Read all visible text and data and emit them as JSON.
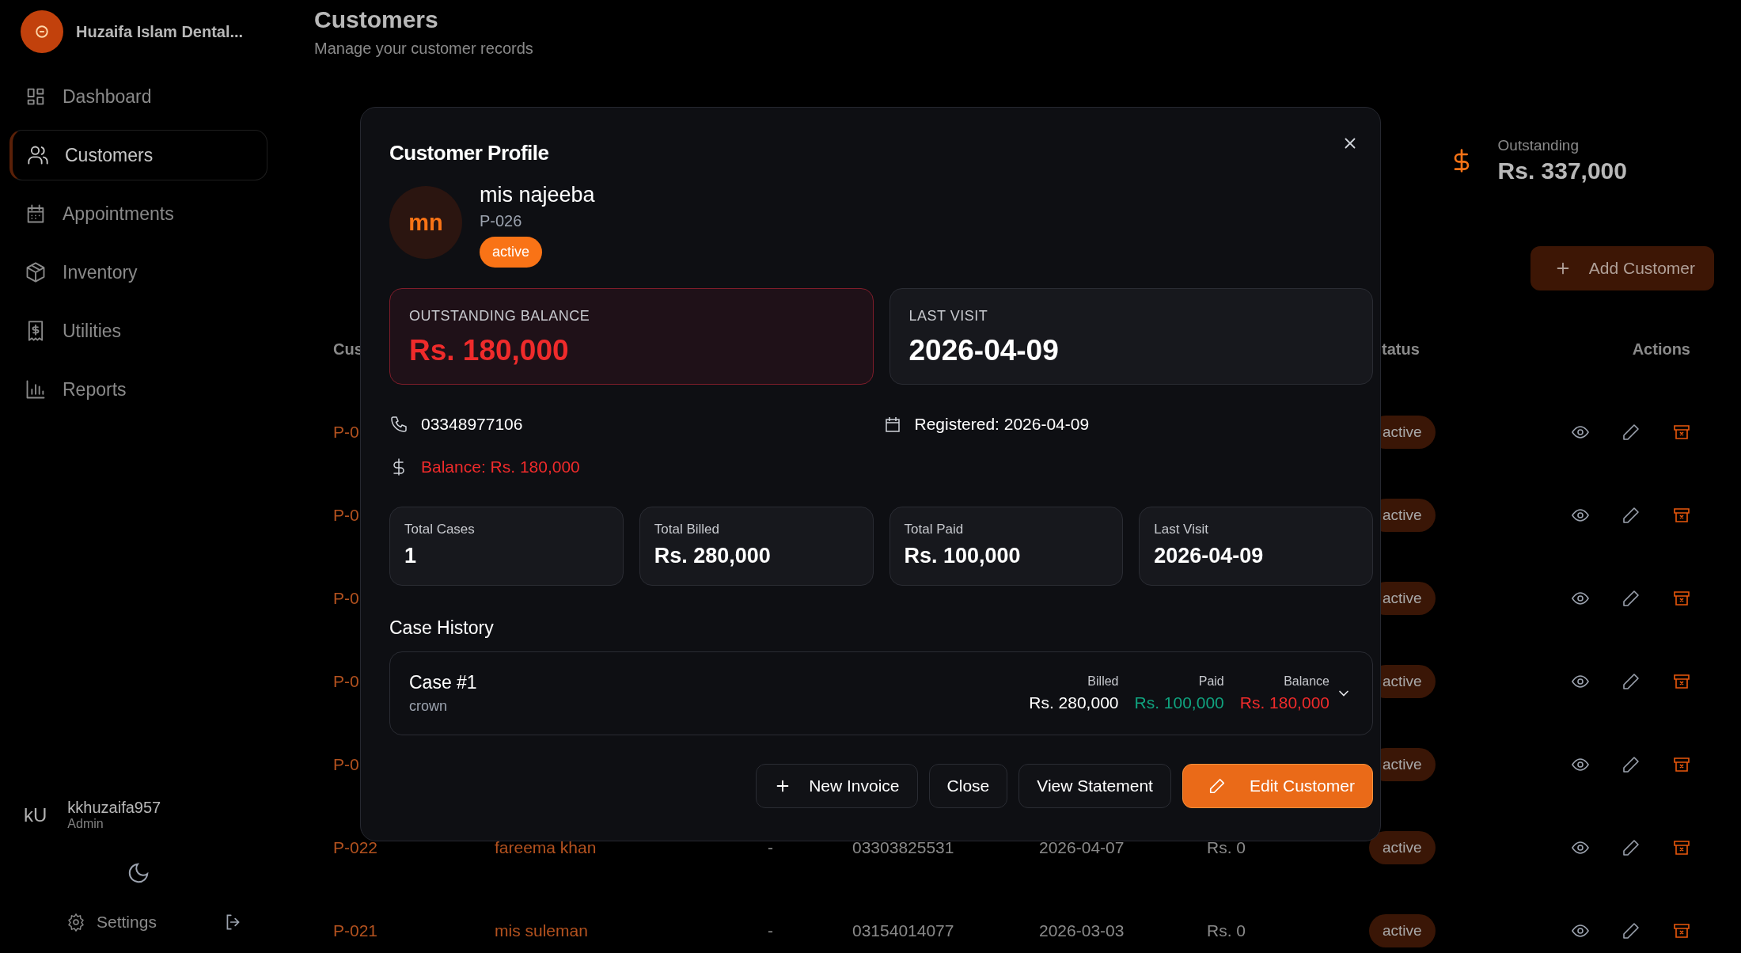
{
  "sidebar": {
    "brand": "Huzaifa Islam Dental...",
    "items": [
      {
        "label": "Dashboard",
        "selected": false
      },
      {
        "label": "Customers",
        "selected": true
      },
      {
        "label": "Appointments",
        "selected": false
      },
      {
        "label": "Inventory",
        "selected": false
      },
      {
        "label": "Utilities",
        "selected": false
      },
      {
        "label": "Reports",
        "selected": false
      }
    ],
    "user": {
      "initials": "kU",
      "name": "kkhuzaifa957",
      "role": "Admin"
    },
    "settings": "Settings"
  },
  "header": {
    "title": "Customers",
    "subtitle": "Manage your customer records"
  },
  "summary": {
    "label": "Outstanding",
    "value": "Rs. 337,000"
  },
  "add_button": "Add Customer",
  "table": {
    "columns": [
      "Cus",
      "tatus",
      "Actions"
    ],
    "rows": [
      {
        "id": "P-0",
        "status": "active"
      },
      {
        "id": "P-0",
        "status": "active"
      },
      {
        "id": "P-0",
        "status": "active"
      },
      {
        "id": "P-0",
        "status": "active"
      },
      {
        "id": "P-0",
        "status": "active"
      },
      {
        "id": "P-022",
        "name": "fareema khan",
        "doctor": "-",
        "phone": "03303825531",
        "last_visit": "2026-04-07",
        "balance": "Rs. 0",
        "status": "active"
      },
      {
        "id": "P-021",
        "name": "mis suleman",
        "doctor": "-",
        "phone": "03154014077",
        "last_visit": "2026-03-03",
        "balance": "Rs. 0",
        "status": "active"
      }
    ]
  },
  "modal": {
    "title": "Customer Profile",
    "initials": "mn",
    "name": "mis najeeba",
    "code": "P-026",
    "status": "active",
    "highlights": [
      {
        "kind": "alert",
        "label": "OUTSTANDING BALANCE",
        "value": "Rs. 180,000"
      },
      {
        "kind": "plain",
        "label": "LAST VISIT",
        "value": "2026-04-09"
      }
    ],
    "phone": "03348977106",
    "registered": "Registered: 2026-04-09",
    "balance": "Balance: Rs. 180,000",
    "stats": [
      {
        "label": "Total Cases",
        "value": "1"
      },
      {
        "label": "Total Billed",
        "value": "Rs. 280,000"
      },
      {
        "label": "Total Paid",
        "value": "Rs. 100,000"
      },
      {
        "label": "Last Visit",
        "value": "2026-04-09"
      }
    ],
    "case_history_title": "Case History",
    "cases": [
      {
        "title": "Case #1",
        "treatment": "crown",
        "expanded": false,
        "amounts": [
          {
            "kind": "billed",
            "label": "Billed",
            "value": "Rs. 280,000"
          },
          {
            "kind": "paid",
            "label": "Paid",
            "value": "Rs. 100,000"
          },
          {
            "kind": "balance",
            "label": "Balance",
            "value": "Rs. 180,000"
          }
        ]
      }
    ],
    "buttons": [
      {
        "kind": "add",
        "label": "New Invoice"
      },
      {
        "kind": "plain",
        "label": "Close"
      },
      {
        "kind": "plain",
        "label": "View Statement"
      },
      {
        "kind": "primary",
        "label": "Edit Customer"
      }
    ]
  }
}
